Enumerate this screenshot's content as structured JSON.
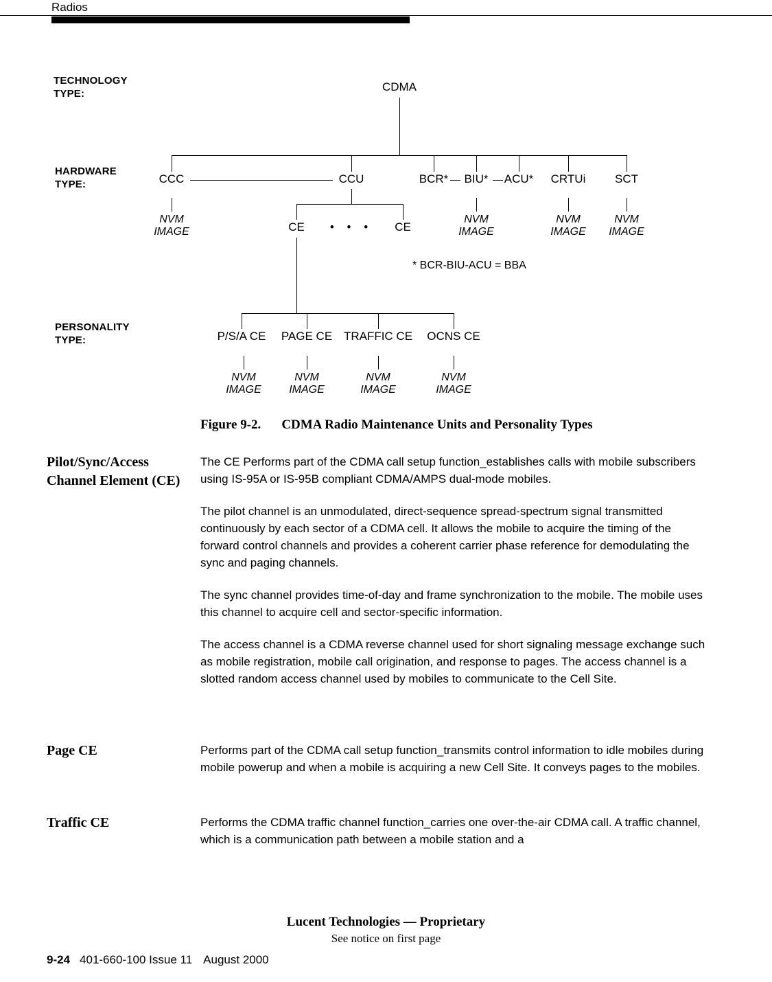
{
  "header": {
    "running_title": "Radios"
  },
  "figure": {
    "row_labels": [
      {
        "id": "technology",
        "text": "TECHNOLOGY\nTYPE:"
      },
      {
        "id": "hardware",
        "text": "HARDWARE\nTYPE:"
      },
      {
        "id": "personality",
        "text": "PERSONALITY\nTYPE:"
      }
    ],
    "technology_node": "CDMA",
    "hardware_nodes": [
      {
        "id": "ccc",
        "label": "CCC"
      },
      {
        "id": "ccu",
        "label": "CCU"
      },
      {
        "id": "bcr",
        "label": "BCR*"
      },
      {
        "id": "biu",
        "label": "BIU*"
      },
      {
        "id": "acu",
        "label": "ACU*"
      },
      {
        "id": "crtui",
        "label": "CRTUi"
      },
      {
        "id": "sct",
        "label": "SCT"
      }
    ],
    "ce_nodes": [
      {
        "id": "ce-left",
        "label": "CE"
      },
      {
        "id": "ce-right",
        "label": "CE"
      }
    ],
    "ce_ellipsis": "• • •",
    "personality_nodes": [
      {
        "id": "psa-ce",
        "label": "P/S/A CE"
      },
      {
        "id": "page-ce",
        "label": "PAGE CE"
      },
      {
        "id": "traffic-ce",
        "label": "TRAFFIC CE"
      },
      {
        "id": "ocns-ce",
        "label": "OCNS CE"
      }
    ],
    "nvm_label": "NVM\nIMAGE",
    "footnote": "* BCR-BIU-ACU = BBA",
    "caption_number": "Figure 9-2.",
    "caption_text": "CDMA Radio Maintenance Units and Personality Types"
  },
  "sections": [
    {
      "id": "pilot-sync-access",
      "heading": "Pilot/Sync/Access Channel Element (CE)",
      "paragraphs": [
        "The CE Performs part of the CDMA call setup function_establishes calls with mobile subscribers using IS-95A or IS-95B compliant CDMA/AMPS dual-mode mobiles.",
        "The pilot channel is an unmodulated, direct-sequence spread-spectrum signal transmitted continuously by each sector of a CDMA cell. It allows the mobile to acquire the timing of the forward control channels and provides a coherent carrier phase reference for demodulating the sync and paging channels.",
        "The sync channel provides time-of-day and frame synchronization to the mobile. The mobile uses this channel to acquire cell and sector-specific information.",
        "The access channel is a CDMA reverse channel used for short signaling message exchange such as mobile registration, mobile call origination, and response to pages. The access channel is a slotted random access channel used by mobiles to communicate to the Cell Site."
      ]
    },
    {
      "id": "page-ce",
      "heading": "Page CE",
      "paragraphs": [
        "Performs part of the CDMA call setup function_transmits control information to idle mobiles during mobile powerup and when a mobile is acquiring a new Cell Site. It conveys pages to the mobiles."
      ]
    },
    {
      "id": "traffic-ce",
      "heading": "Traffic CE",
      "paragraphs": [
        "Performs the CDMA traffic channel function_carries one over-the-air CDMA call. A traffic channel, which is a communication path between a mobile station and a"
      ]
    }
  ],
  "footer": {
    "notice_line1": "Lucent Technologies — Proprietary",
    "notice_line2": "See notice on first page",
    "page_number": "9-24",
    "document_id": "401-660-100 Issue 11",
    "date": "August 2000"
  }
}
